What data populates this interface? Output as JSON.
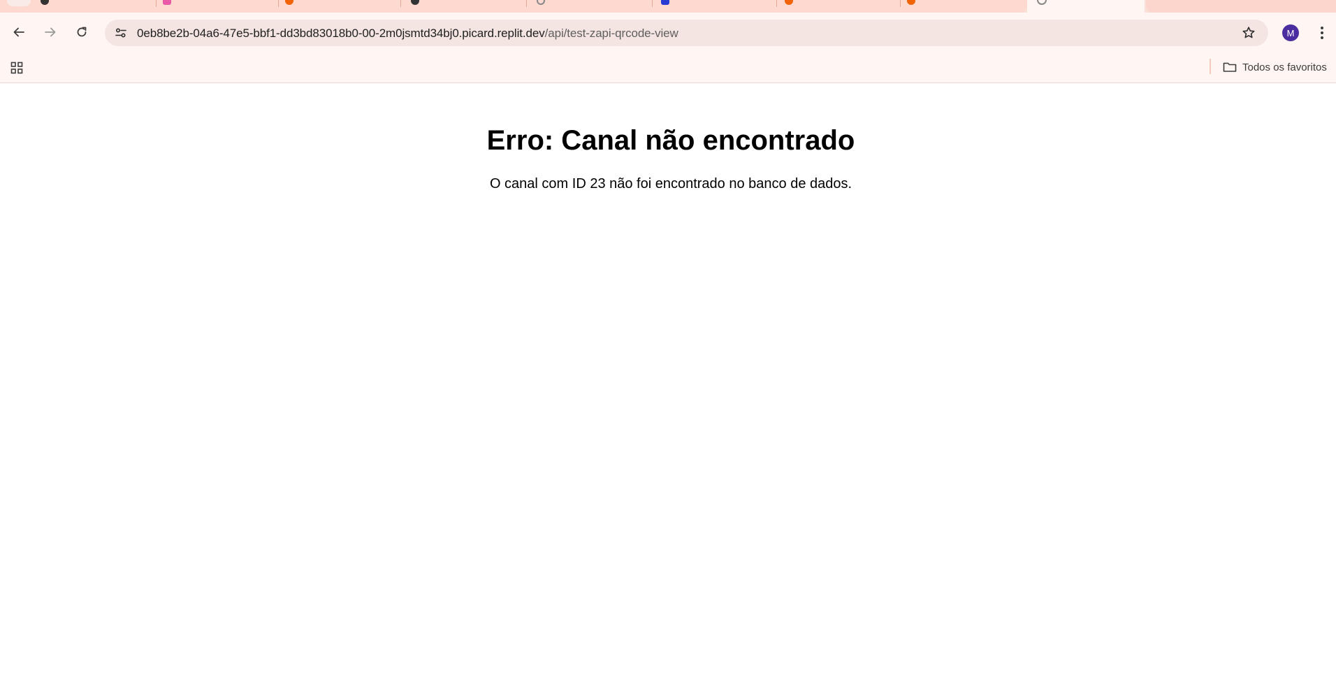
{
  "browser": {
    "tabs": [
      {
        "favicon": "github-icon",
        "color": "#333333"
      },
      {
        "favicon": "app-icon",
        "color": "#e85aa8"
      },
      {
        "favicon": "replit-icon",
        "color": "#f26207"
      },
      {
        "favicon": "github-icon",
        "color": "#333333"
      },
      {
        "favicon": "globe-icon",
        "color": "#888888"
      },
      {
        "favicon": "app-icon",
        "color": "#2a3bd1"
      },
      {
        "favicon": "replit-icon",
        "color": "#f26207"
      },
      {
        "favicon": "replit-icon",
        "color": "#f26207"
      }
    ],
    "active_tab": {
      "favicon": "globe-icon"
    },
    "address_bar": {
      "host": "0eb8be2b-04a6-47e5-bbf1-dd3bd83018b0-00-2m0jsmtd34bj0.picard.replit.dev",
      "path": "/api/test-zapi-qrcode-view"
    },
    "profile_initial": "M",
    "bookmarks_bar": {
      "all_bookmarks_label": "Todos os favoritos"
    },
    "colors": {
      "tab_strip": "#fdd9cf",
      "toolbar": "#fff5f2",
      "omnibox": "#f4e5e2",
      "profile": "#4a2ea0"
    }
  },
  "page": {
    "title": "Erro: Canal não encontrado",
    "message": "O canal com ID 23 não foi encontrado no banco de dados."
  }
}
